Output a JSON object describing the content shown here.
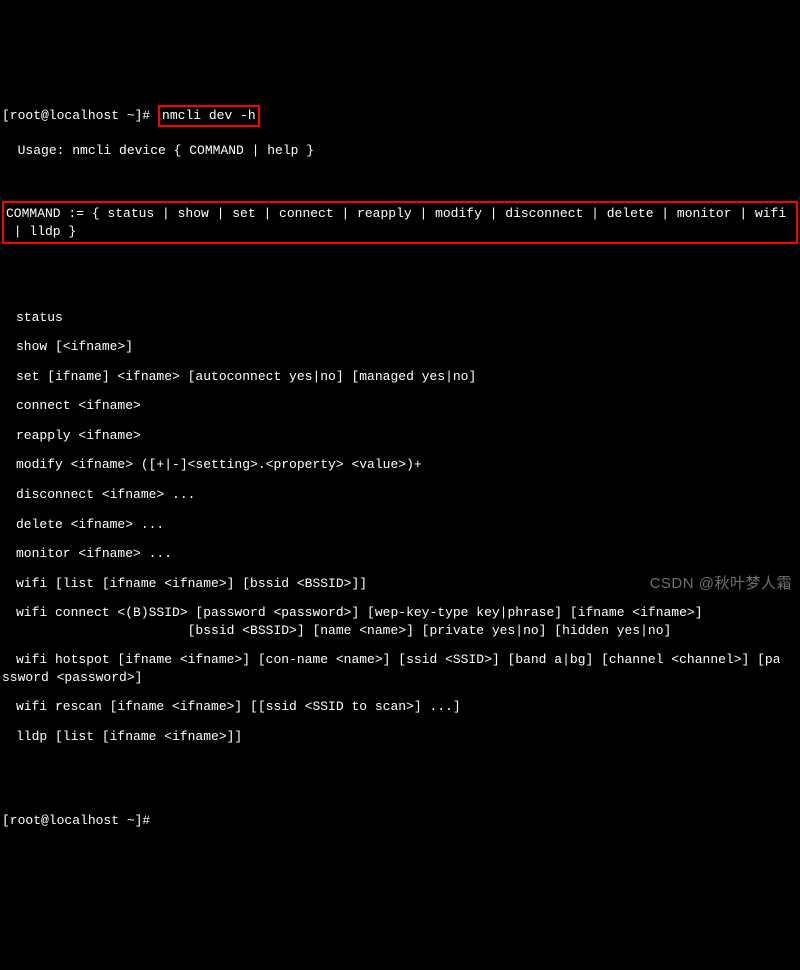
{
  "prompt": {
    "user_host": "[root@localhost ~]#",
    "command": "nmcli dev -h"
  },
  "usage_line": "Usage: nmcli device { COMMAND | help }",
  "command_box": {
    "line1": "COMMAND := { status | show | set | connect | reapply | modify | disconnect | delete | monitor | wifi",
    "line2": " | lldp }"
  },
  "commands": [
    "status",
    "show [<ifname>]",
    "set [ifname] <ifname> [autoconnect yes|no] [managed yes|no]",
    "connect <ifname>",
    "reapply <ifname>",
    "modify <ifname> ([+|-]<setting>.<property> <value>)+",
    "disconnect <ifname> ...",
    "delete <ifname> ...",
    "monitor <ifname> ...",
    "wifi [list [ifname <ifname>] [bssid <BSSID>]]",
    "wifi connect <(B)SSID> [password <password>] [wep-key-type key|phrase] [ifname <ifname>]",
    "                      [bssid <BSSID>] [name <name>] [private yes|no] [hidden yes|no]",
    "wifi hotspot [ifname <ifname>] [con-name <name>] [ssid <SSID>] [band a|bg] [channel <channel>] [pa",
    "ssword <password>]",
    "wifi rescan [ifname <ifname>] [[ssid <SSID to scan>] ...]",
    "lldp [list [ifname <ifname>]]"
  ],
  "continuation_indices": [
    11,
    13
  ],
  "unindented_indices": [
    13
  ],
  "bottom_prompt": "[root@localhost ~]#",
  "watermark": "CSDN @秋叶梦人霜"
}
